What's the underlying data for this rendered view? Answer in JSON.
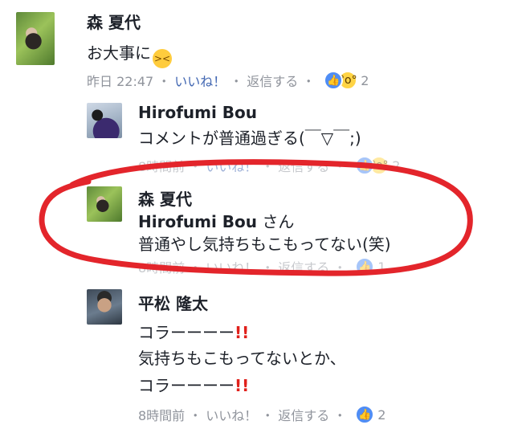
{
  "comments": [
    {
      "author": "森 夏代",
      "lines": [
        "お大事に"
      ],
      "inline_emoji": "confounded-face",
      "meta": {
        "time": "昨日 22:47",
        "like": "いいね！",
        "reply": "返信する",
        "reaction_count": "2"
      },
      "reactions": [
        "like",
        "wow"
      ]
    },
    {
      "author": "Hirofumi Bou",
      "lines": [
        "コメントが普通過ぎる(￣▽￣;)"
      ],
      "meta": {
        "time": "8時間前",
        "like": "いいね！",
        "reply": "返信する",
        "reaction_count": "2"
      },
      "reactions": [
        "like",
        "wow"
      ]
    },
    {
      "author": "森 夏代",
      "mention": "Hirofumi Bou",
      "mention_suffix": "さん",
      "lines": [
        "普通やし気持ちもこもってない(笑)"
      ],
      "meta": {
        "time": "8時間前",
        "like": "いいね！",
        "reply": "返信する",
        "reaction_count": "1"
      },
      "reactions": [
        "like"
      ]
    },
    {
      "author": "平松 隆太",
      "lines": [
        "コラーーーー",
        "気持ちもこもってないとか、",
        "コラーーーー"
      ],
      "line_suffix": "!!",
      "meta": {
        "time": "8時間前",
        "like": "いいね！",
        "reply": "返信する",
        "reaction_count": "2"
      },
      "reactions": [
        "like"
      ]
    }
  ],
  "meta_separator": "・",
  "colors": {
    "highlight_circle": "#e3252b",
    "like_blue": "#4f8df5",
    "meta_gray": "#90949c"
  }
}
